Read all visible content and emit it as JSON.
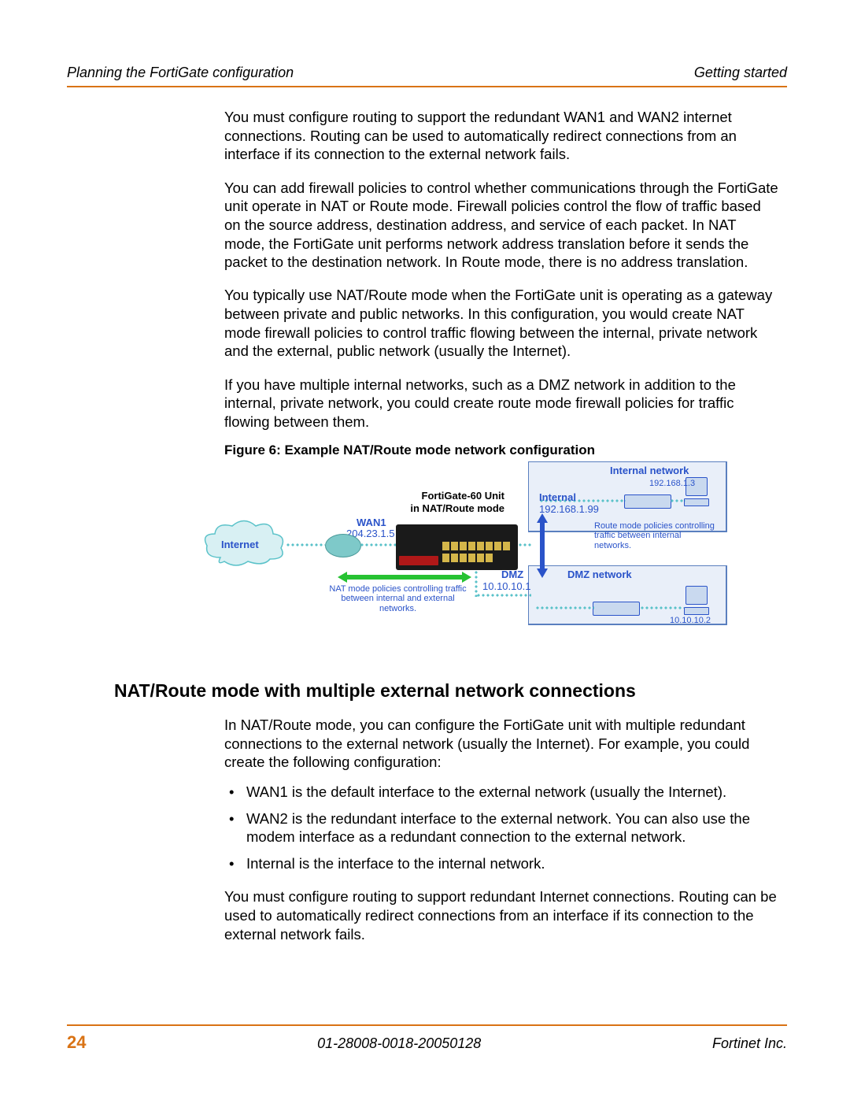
{
  "header": {
    "left": "Planning the FortiGate configuration",
    "right": "Getting started"
  },
  "paragraphs": {
    "p1": "You must configure routing to support the redundant WAN1 and WAN2 internet connections. Routing can be used to automatically redirect connections from an interface if its connection to the external network fails.",
    "p2": "You can add firewall policies to control whether communications through the FortiGate unit operate in NAT or Route mode. Firewall policies control the flow of traffic based on the source address, destination address, and service of each packet. In NAT mode, the FortiGate unit performs network address translation before it sends the packet to the destination network. In Route mode, there is no address translation.",
    "p3": "You typically use NAT/Route mode when the FortiGate unit is operating as a gateway between private and public networks. In this configuration, you would create NAT mode firewall policies to control traffic flowing between the internal, private network and the external, public network (usually the Internet).",
    "p4": "If you have multiple internal networks, such as a DMZ network in addition to the internal, private network, you could create route mode firewall policies for traffic flowing between them."
  },
  "figure": {
    "caption": "Figure 6: Example NAT/Route mode network configuration",
    "internet": "Internet",
    "wan1": "WAN1",
    "wan1_ip": "204.23.1.5",
    "unit_line1": "FortiGate-60 Unit",
    "unit_line2": "in NAT/Route mode",
    "internal": "Internal",
    "internal_ip": "192.168.1.99",
    "internal_net": "Internal network",
    "pc_ip": "192.168.1.3",
    "dmz": "DMZ",
    "dmz_ip": "10.10.10.1",
    "dmz_net": "DMZ network",
    "dmz_pc_ip": "10.10.10.2",
    "nat_note": "NAT mode policies controlling traffic between internal and external networks.",
    "route_note": "Route mode policies controlling traffic between internal networks."
  },
  "h2": "NAT/Route mode with multiple external network connections",
  "section2": {
    "intro": "In NAT/Route mode, you can configure the FortiGate unit with multiple redundant connections to the external network (usually the Internet). For example, you could create the following configuration:",
    "b1": "WAN1 is the default interface to the external network (usually the Internet).",
    "b2": "WAN2 is the redundant interface to the external network. You can also use the modem interface as a redundant connection to the external network.",
    "b3": "Internal is the interface to the internal network.",
    "outro": "You must configure routing to support redundant Internet connections. Routing can be used to automatically redirect connections from an interface if its connection to the external network fails."
  },
  "footer": {
    "page": "24",
    "center": "01-28008-0018-20050128",
    "right": "Fortinet Inc."
  }
}
